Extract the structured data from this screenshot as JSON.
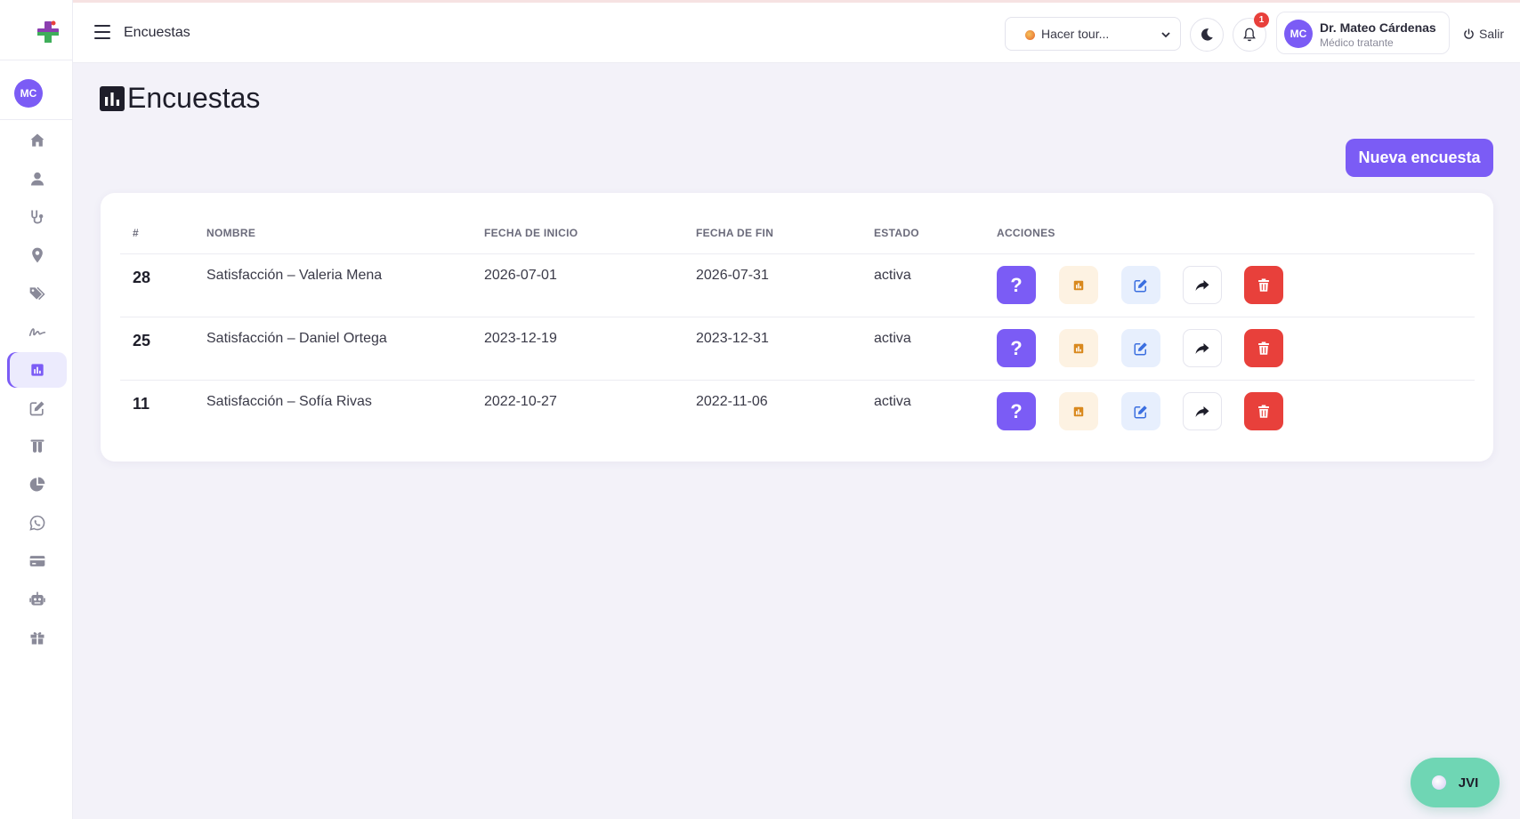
{
  "header": {
    "title": "Encuestas",
    "tour_placeholder": "Hacer tour...",
    "notification_count": "1",
    "user": {
      "initials": "MC",
      "name": "Dr. Mateo Cárdenas",
      "role": "Médico tratante"
    },
    "logout_label": "Salir"
  },
  "sidebar": {
    "avatar_initials": "MC",
    "items": [
      {
        "name": "home",
        "icon": "home-icon"
      },
      {
        "name": "patients",
        "icon": "user-icon"
      },
      {
        "name": "medical",
        "icon": "stethoscope-icon"
      },
      {
        "name": "locations",
        "icon": "map-pin-icon"
      },
      {
        "name": "tags",
        "icon": "tags-icon"
      },
      {
        "name": "signature",
        "icon": "signature-icon"
      },
      {
        "name": "surveys",
        "icon": "chart-bar-icon",
        "active": true
      },
      {
        "name": "forms",
        "icon": "edit-icon"
      },
      {
        "name": "lab",
        "icon": "test-tubes-icon"
      },
      {
        "name": "reports",
        "icon": "pie-chart-icon"
      },
      {
        "name": "whatsapp",
        "icon": "whatsapp-icon"
      },
      {
        "name": "payments",
        "icon": "credit-card-icon"
      },
      {
        "name": "bot",
        "icon": "robot-icon"
      },
      {
        "name": "gifts",
        "icon": "gift-icon"
      }
    ]
  },
  "page": {
    "title": "Encuestas",
    "new_button": "Nueva encuesta"
  },
  "table": {
    "columns": [
      "#",
      "NOMBRE",
      "FECHA DE INICIO",
      "FECHA DE FIN",
      "ESTADO",
      "ACCIONES"
    ],
    "rows": [
      {
        "id": "28",
        "name": "Satisfacción – Valeria Mena",
        "start": "2026-07-01",
        "end": "2026-07-31",
        "status": "activa"
      },
      {
        "id": "25",
        "name": "Satisfacción – Daniel Ortega",
        "start": "2023-12-19",
        "end": "2023-12-31",
        "status": "activa"
      },
      {
        "id": "11",
        "name": "Satisfacción – Sofía Rivas",
        "start": "2022-10-27",
        "end": "2022-11-06",
        "status": "activa"
      }
    ],
    "action_icons": [
      "question-icon",
      "chart-bar-icon",
      "edit-icon",
      "share-icon",
      "trash-icon"
    ]
  },
  "chat_widget": {
    "label": "JVI"
  },
  "colors": {
    "accent": "#7b5cf5",
    "danger": "#e8403b",
    "stats": "#d9891e",
    "edit": "#3b6fe0",
    "chat": "#6fd6b4",
    "background": "#f3f2f9"
  }
}
